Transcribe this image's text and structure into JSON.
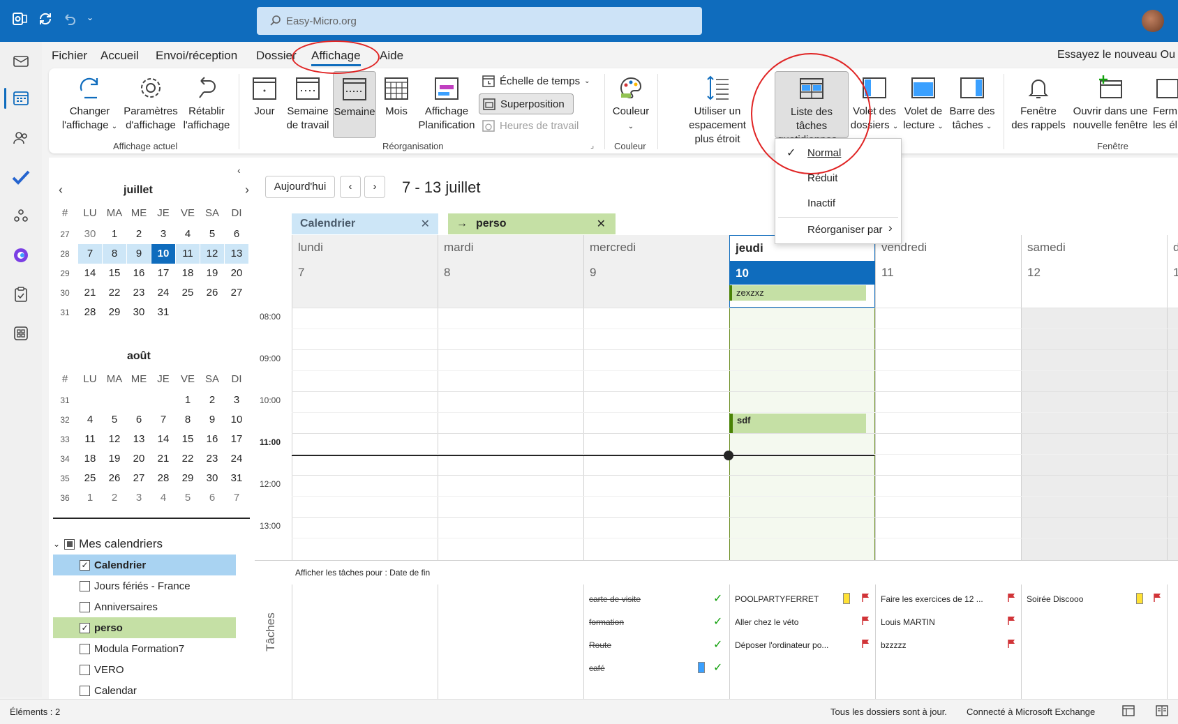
{
  "titlebar": {
    "search_placeholder": "Easy-Micro.org"
  },
  "menu": {
    "items": [
      "Fichier",
      "Accueil",
      "Envoi/réception",
      "Dossier",
      "Affichage",
      "Aide"
    ],
    "try_new": "Essayez le nouveau Ou"
  },
  "ribbon": {
    "changer": [
      "Changer",
      "l'affichage"
    ],
    "parametres": [
      "Paramètres",
      "d'affichage"
    ],
    "retablir": [
      "Rétablir",
      "l'affichage"
    ],
    "group_affichage_actuel": "Affichage actuel",
    "jour": "Jour",
    "semaine_travail": [
      "Semaine",
      "de travail"
    ],
    "semaine": "Semaine",
    "mois": "Mois",
    "planif": [
      "Affichage",
      "Planification"
    ],
    "echelle": "Échelle de temps",
    "superposition": "Superposition",
    "heures_travail": "Heures de travail",
    "group_reorg": "Réorganisation",
    "couleur": "Couleur",
    "group_couleur": "Couleur",
    "espacement": [
      "Utiliser un espacement",
      "plus étroit"
    ],
    "liste_taches": [
      "Liste des tâches",
      "quotidiennes"
    ],
    "volet_dossiers": [
      "Volet des",
      "dossiers"
    ],
    "volet_lecture": [
      "Volet de",
      "lecture"
    ],
    "barre_taches": [
      "Barre des",
      "tâches"
    ],
    "rappels": [
      "Fenêtre",
      "des rappels"
    ],
    "nouvelle_fenetre": [
      "Ouvrir dans une",
      "nouvelle fenêtre"
    ],
    "fermer": [
      "Ferm",
      "les él"
    ],
    "group_fenetre": "Fenêtre"
  },
  "dropdown": {
    "items": [
      "Normal",
      "Réduit",
      "Inactif",
      "Réorganiser par"
    ]
  },
  "datepicker": {
    "july": {
      "title": "juillet",
      "headers": [
        "#",
        "LU",
        "MA",
        "ME",
        "JE",
        "VE",
        "SA",
        "DI"
      ],
      "weeks": [
        [
          "27",
          "30",
          "1",
          "2",
          "3",
          "4",
          "5",
          "6"
        ],
        [
          "28",
          "7",
          "8",
          "9",
          "10",
          "11",
          "12",
          "13"
        ],
        [
          "29",
          "14",
          "15",
          "16",
          "17",
          "18",
          "19",
          "20"
        ],
        [
          "30",
          "21",
          "22",
          "23",
          "24",
          "25",
          "26",
          "27"
        ],
        [
          "31",
          "28",
          "29",
          "30",
          "31",
          "",
          "",
          ""
        ]
      ]
    },
    "august": {
      "title": "août",
      "headers": [
        "#",
        "LU",
        "MA",
        "ME",
        "JE",
        "VE",
        "SA",
        "DI"
      ],
      "weeks": [
        [
          "31",
          "",
          "",
          "",
          "",
          "1",
          "2",
          "3"
        ],
        [
          "32",
          "4",
          "5",
          "6",
          "7",
          "8",
          "9",
          "10"
        ],
        [
          "33",
          "11",
          "12",
          "13",
          "14",
          "15",
          "16",
          "17"
        ],
        [
          "34",
          "18",
          "19",
          "20",
          "21",
          "22",
          "23",
          "24"
        ],
        [
          "35",
          "25",
          "26",
          "27",
          "28",
          "29",
          "30",
          "31"
        ],
        [
          "36",
          "1",
          "2",
          "3",
          "4",
          "5",
          "6",
          "7"
        ]
      ]
    }
  },
  "calendars": {
    "group": "Mes calendriers",
    "items": [
      {
        "name": "Calendrier",
        "checked": true
      },
      {
        "name": "Jours fériés - France",
        "checked": false
      },
      {
        "name": "Anniversaires",
        "checked": false
      },
      {
        "name": "perso",
        "checked": true
      },
      {
        "name": "Modula Formation7",
        "checked": false
      },
      {
        "name": "VERO",
        "checked": false
      },
      {
        "name": "Calendar",
        "checked": false
      }
    ]
  },
  "main": {
    "today": "Aujourd'hui",
    "range": "7 - 13 juillet",
    "tab_calendrier": "Calendrier",
    "tab_perso": "perso",
    "days": [
      {
        "name": "lundi",
        "num": "7"
      },
      {
        "name": "mardi",
        "num": "8"
      },
      {
        "name": "mercredi",
        "num": "9"
      },
      {
        "name": "jeudi",
        "num": "10"
      },
      {
        "name": "vendredi",
        "num": "11"
      },
      {
        "name": "samedi",
        "num": "12"
      },
      {
        "name": "d",
        "num": "1"
      }
    ],
    "allday_event": "zexzxz",
    "event": "sdf",
    "times": [
      "08:00",
      "09:00",
      "10:00",
      "11:00",
      "12:00",
      "13:00"
    ],
    "tasks_filter": "Afficher les tâches pour : Date de fin",
    "tasks_label": "Tâches",
    "tasks_wed": [
      "carte de visite",
      "formation",
      "Route",
      "café"
    ],
    "tasks_thu": [
      "POOLPARTYFERRET",
      "Aller chez le véto",
      "Déposer l'ordinateur po..."
    ],
    "tasks_fri": [
      "Faire les exercices de 12 ...",
      "Louis MARTIN",
      "bzzzzz"
    ],
    "tasks_sat": [
      "Soirée Discooo"
    ]
  },
  "status": {
    "left": "Éléments : 2",
    "sync": "Tous les dossiers sont à jour.",
    "conn": "Connecté à Microsoft Exchange"
  },
  "colors": {
    "accent": "#0f6cbd",
    "perso": "#c5e0a5",
    "calendrier": "#cde6f7",
    "annotation": "#e02424"
  }
}
